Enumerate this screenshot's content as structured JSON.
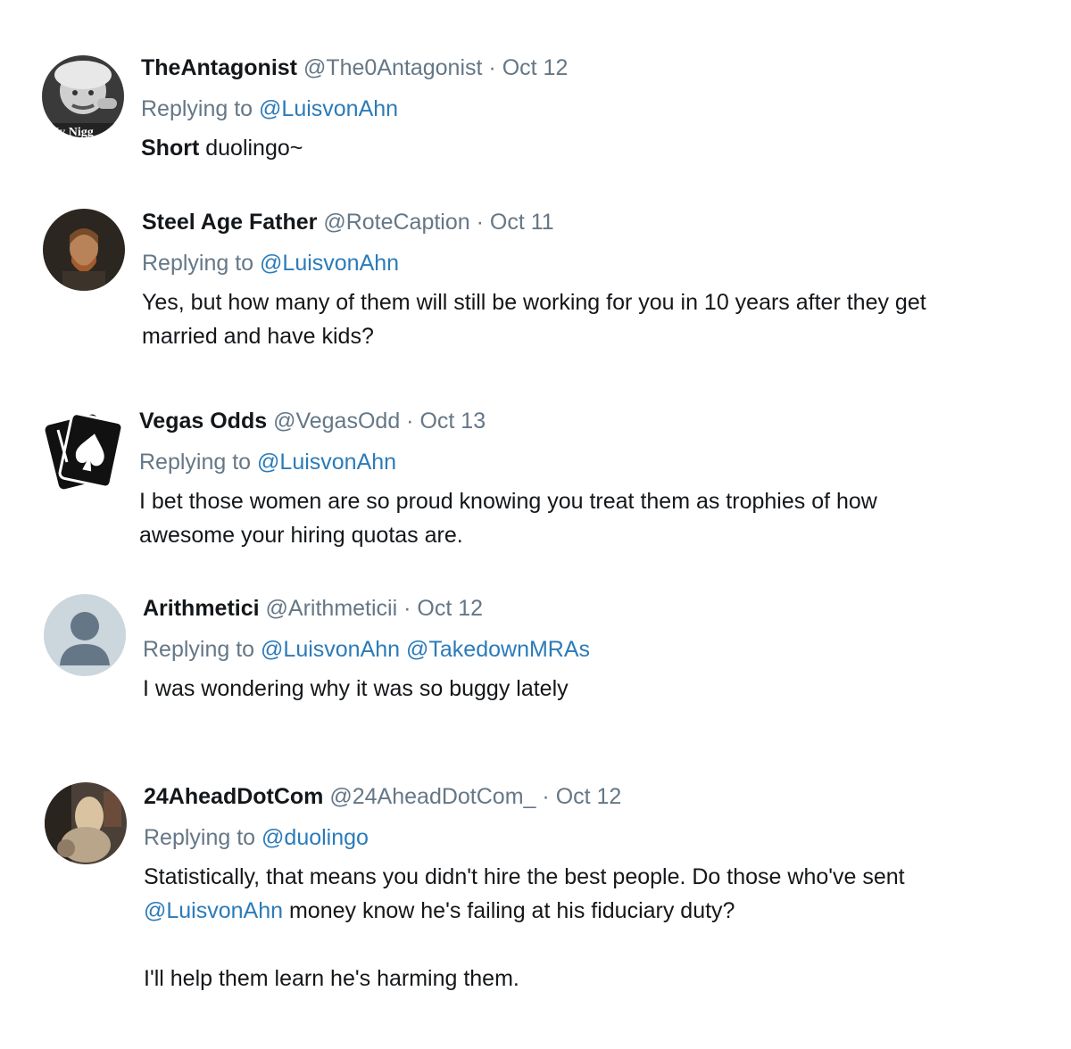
{
  "tweets": [
    {
      "name": "TheAntagonist",
      "handle": "@The0Antagonist",
      "date": "Oct 12",
      "replying_prefix": "Replying to",
      "replying_to": [
        "@LuisvonAhn"
      ],
      "text_bold": "Short",
      "text": " duolingo~",
      "avatar_caption": "My Nigg"
    },
    {
      "name": "Steel Age Father",
      "handle": "@RoteCaption",
      "date": "Oct 11",
      "replying_prefix": "Replying to",
      "replying_to": [
        "@LuisvonAhn"
      ],
      "text": "Yes, but how many of them will still be working for you in 10 years after they get married and have kids?"
    },
    {
      "name": "Vegas Odds",
      "handle": "@VegasOdd",
      "date": "Oct 13",
      "replying_prefix": "Replying to",
      "replying_to": [
        "@LuisvonAhn"
      ],
      "text": "I bet those women are so proud knowing you treat them as trophies of how awesome your hiring quotas are."
    },
    {
      "name": "Arithmetici",
      "handle": "@Arithmeticii",
      "date": "Oct 12",
      "replying_prefix": "Replying to",
      "replying_to": [
        "@LuisvonAhn",
        "@TakedownMRAs"
      ],
      "text": "I was wondering why it was so buggy lately"
    },
    {
      "name": "24AheadDotCom",
      "handle": "@24AheadDotCom_",
      "date": "Oct 12",
      "replying_prefix": "Replying to",
      "replying_to": [
        "@duolingo"
      ],
      "text_a": "Statistically, that means you didn't hire the best people. Do those who've sent ",
      "text_mention": "@LuisvonAhn",
      "text_b": " money know he's failing at his fiduciary duty?",
      "text_c": "I'll help them learn he's harming them."
    }
  ],
  "separator": "·"
}
